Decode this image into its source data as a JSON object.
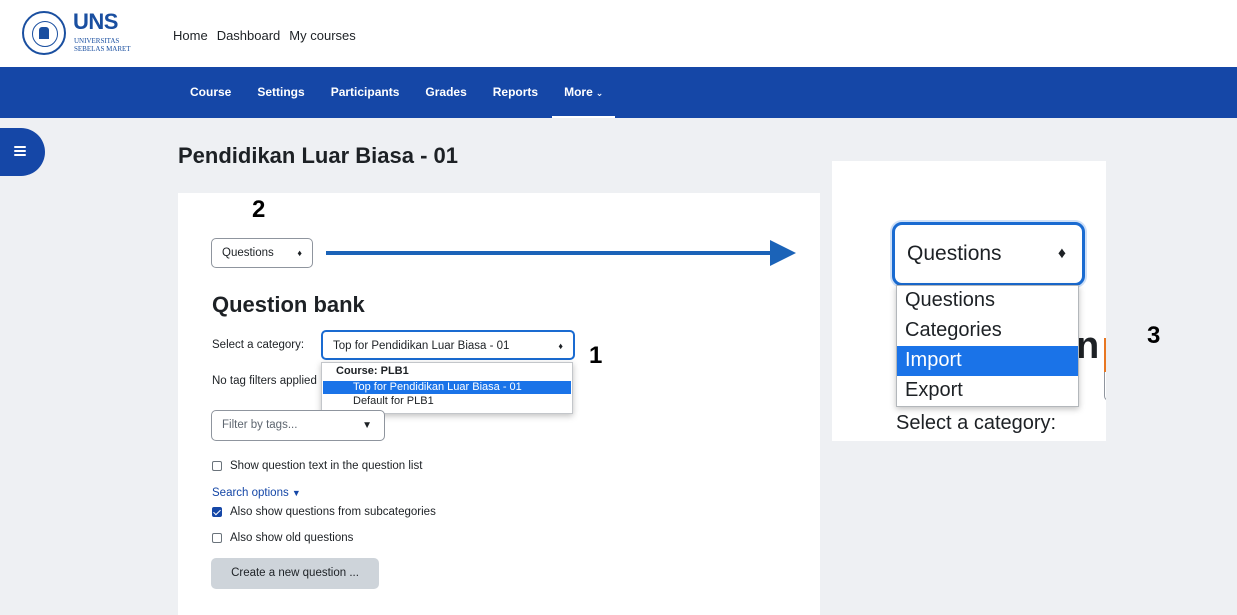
{
  "brand": {
    "name": "UNS",
    "subtitle": "Universitas Sebelas Maret"
  },
  "topnav": [
    "Home",
    "Dashboard",
    "My courses"
  ],
  "coursenav": [
    {
      "label": "Course"
    },
    {
      "label": "Settings"
    },
    {
      "label": "Participants"
    },
    {
      "label": "Grades"
    },
    {
      "label": "Reports"
    },
    {
      "label": "More"
    }
  ],
  "page_title": "Pendidikan Luar Biasa - 01",
  "annotations": {
    "n1": "1",
    "n2": "2",
    "n3": "3"
  },
  "nav_select": {
    "value": "Questions"
  },
  "question_bank": {
    "title": "Question bank",
    "category_label": "Select a category:",
    "category_value": "Top for Pendidikan Luar Biasa - 01",
    "category_dropdown": {
      "group": "Course: PLB1",
      "options": [
        "Top for Pendidikan Luar Biasa - 01",
        "Default for PLB1"
      ]
    },
    "no_tag_filters": "No tag filters applied",
    "filter_placeholder": "Filter by tags...",
    "show_text_label": "Show question text in the question list",
    "search_options": "Search options",
    "subcat_label": "Also show questions from subcategories",
    "old_label": "Also show old questions",
    "create_button": "Create a new question ..."
  },
  "zoom": {
    "select_value": "Questions",
    "options": [
      "Questions",
      "Categories",
      "Import",
      "Export"
    ],
    "highlighted": "Import",
    "category_label": "Select a category:",
    "heading_fragment": "n"
  },
  "colors": {
    "nav": "#1547a7",
    "highlight": "#1a73e8",
    "arrow": "#1b63b8"
  }
}
